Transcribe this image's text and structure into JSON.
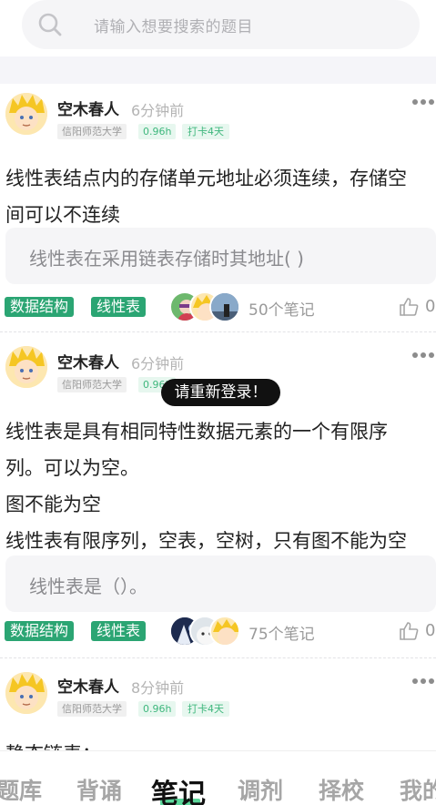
{
  "search": {
    "placeholder": "请输入想要搜索的题目",
    "icon": "search-icon"
  },
  "posts": [
    {
      "author": "空木春人",
      "time": "6分钟前",
      "school": "信阳师范大学",
      "hours": "0.96h",
      "checkin": "打卡4天",
      "body": [
        "线性表结点内的存储单元地址必须连续，存储空",
        "间可以不连续"
      ],
      "question": "线性表在采用链表存储时其地址( )",
      "tags": [
        "数据结构",
        "线性表"
      ],
      "notes": "50个笔记",
      "likes": "0"
    },
    {
      "author": "空木春人",
      "time": "6分钟前",
      "school": "信阳师范大学",
      "hours": "0.96h",
      "body": [
        "线性表是具有相同特性数据元素的一个有限序",
        "列。可以为空。",
        "图不能为空",
        "线性表有限序列，空表，空树，只有图不能为空"
      ],
      "question": "线性表是（）。",
      "tags": [
        "数据结构",
        "线性表"
      ],
      "notes": "75个笔记",
      "likes": "0"
    },
    {
      "author": "空木春人",
      "time": "8分钟前",
      "school": "信阳师范大学",
      "hours": "0.96h",
      "checkin": "打卡4天",
      "body": [
        "静态链表："
      ]
    }
  ],
  "toast": "请重新登录！",
  "tabs": [
    {
      "label": "题库",
      "active": false
    },
    {
      "label": "背诵",
      "active": false
    },
    {
      "label": "笔记",
      "active": true
    },
    {
      "label": "调剂",
      "active": false
    },
    {
      "label": "择校",
      "active": false
    },
    {
      "label": "我的",
      "active": false
    }
  ],
  "colors": {
    "accent": "#2ba573",
    "tab_highlight": "#3fd089",
    "muted": "#9a9a9a"
  }
}
